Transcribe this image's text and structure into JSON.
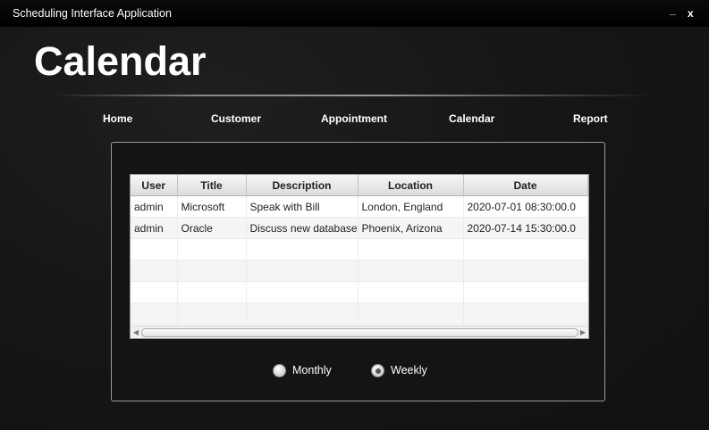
{
  "window": {
    "title": "Scheduling Interface Application",
    "minimize_label": "_",
    "close_label": "x"
  },
  "header": {
    "title": "Calendar"
  },
  "nav": {
    "items": [
      {
        "label": "Home"
      },
      {
        "label": "Customer"
      },
      {
        "label": "Appointment"
      },
      {
        "label": "Calendar"
      },
      {
        "label": "Report"
      }
    ]
  },
  "table": {
    "columns": [
      "User",
      "Title",
      "Description",
      "Location",
      "Date"
    ],
    "rows": [
      [
        "admin",
        "Microsoft",
        "Speak with Bill",
        "London, England",
        "2020-07-01 08:30:00.0"
      ],
      [
        "admin",
        "Oracle",
        "Discuss new database",
        "Phoenix, Arizona",
        "2020-07-14 15:30:00.0"
      ]
    ],
    "scroll_left_icon": "arrow-left-icon",
    "scroll_right_icon": "arrow-right-icon"
  },
  "view_options": {
    "options": [
      {
        "label": "Monthly",
        "selected": false
      },
      {
        "label": "Weekly",
        "selected": true
      }
    ]
  },
  "colors": {
    "background": "#141414",
    "titlebar": "#000000",
    "text": "#ffffff",
    "table_header": "#e4e4e4"
  }
}
